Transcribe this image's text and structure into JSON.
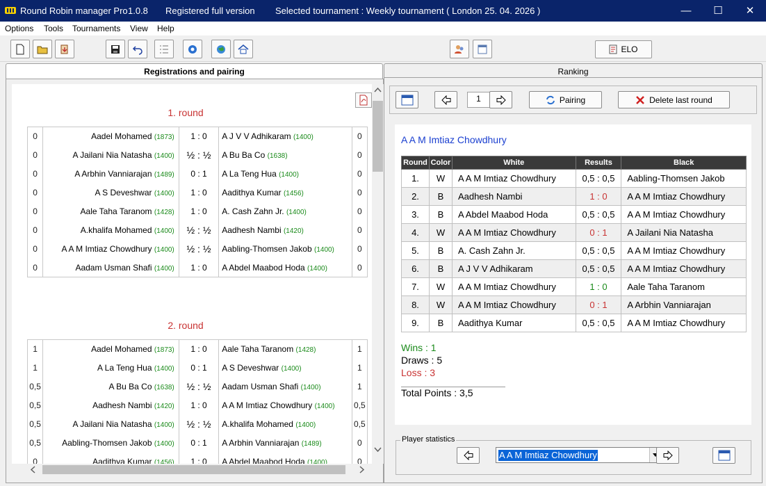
{
  "titlebar": {
    "app_name": "Round Robin manager Pro",
    "version": "1.0.8",
    "license": "Registered full version",
    "selected_tournament": "Selected tournament : Weekly tournament  ( London 25. 04. 2026 )",
    "minimize": "—",
    "maximize": "☐",
    "close": "✕"
  },
  "menu": {
    "options": "Options",
    "tools": "Tools",
    "tournaments": "Tournaments",
    "view": "View",
    "help": "Help"
  },
  "toolbar": {
    "elo_label": "ELO"
  },
  "tabs": {
    "registrations": "Registrations and pairing",
    "ranking": "Ranking"
  },
  "rounds": [
    {
      "title": "1. round",
      "pairings": [
        {
          "ws": "0",
          "white": "Aadel Mohamed",
          "wr": "(1873)",
          "result": "1 : 0",
          "black": "A J V V Adhikaram",
          "br": "(1400)",
          "bs": "0"
        },
        {
          "ws": "0",
          "white": "A Jailani Nia Natasha",
          "wr": "(1400)",
          "result": "½ : ½",
          "black": "A Bu Ba Co",
          "br": "(1638)",
          "bs": "0"
        },
        {
          "ws": "0",
          "white": "A Arbhin Vanniarajan",
          "wr": "(1489)",
          "result": "0 : 1",
          "black": "A La Teng Hua",
          "br": "(1400)",
          "bs": "0"
        },
        {
          "ws": "0",
          "white": "A S Deveshwar",
          "wr": "(1400)",
          "result": "1 : 0",
          "black": "Aadithya Kumar",
          "br": "(1456)",
          "bs": "0"
        },
        {
          "ws": "0",
          "white": "Aale Taha Taranom",
          "wr": "(1428)",
          "result": "1 : 0",
          "black": "A. Cash Zahn Jr.",
          "br": "(1400)",
          "bs": "0"
        },
        {
          "ws": "0",
          "white": "A.khalifa Mohamed",
          "wr": "(1400)",
          "result": "½ : ½",
          "black": "Aadhesh Nambi",
          "br": "(1420)",
          "bs": "0"
        },
        {
          "ws": "0",
          "white": "A A M Imtiaz Chowdhury",
          "wr": "(1400)",
          "result": "½ : ½",
          "black": "Aabling-Thomsen Jakob",
          "br": "(1400)",
          "bs": "0"
        },
        {
          "ws": "0",
          "white": "Aadam Usman Shafi",
          "wr": "(1400)",
          "result": "1 : 0",
          "black": "A Abdel Maabod Hoda",
          "br": "(1400)",
          "bs": "0"
        }
      ]
    },
    {
      "title": "2. round",
      "pairings": [
        {
          "ws": "1",
          "white": "Aadel Mohamed",
          "wr": "(1873)",
          "result": "1 : 0",
          "black": "Aale Taha Taranom",
          "br": "(1428)",
          "bs": "1"
        },
        {
          "ws": "1",
          "white": "A La Teng Hua",
          "wr": "(1400)",
          "result": "0 : 1",
          "black": "A S Deveshwar",
          "br": "(1400)",
          "bs": "1"
        },
        {
          "ws": "0,5",
          "white": "A Bu Ba Co",
          "wr": "(1638)",
          "result": "½ : ½",
          "black": "Aadam Usman Shafi",
          "br": "(1400)",
          "bs": "1"
        },
        {
          "ws": "0,5",
          "white": "Aadhesh Nambi",
          "wr": "(1420)",
          "result": "1 : 0",
          "black": "A A M Imtiaz Chowdhury",
          "br": "(1400)",
          "bs": "0,5"
        },
        {
          "ws": "0,5",
          "white": "A Jailani Nia Natasha",
          "wr": "(1400)",
          "result": "½ : ½",
          "black": "A.khalifa Mohamed",
          "br": "(1400)",
          "bs": "0,5"
        },
        {
          "ws": "0,5",
          "white": "Aabling-Thomsen Jakob",
          "wr": "(1400)",
          "result": "0 : 1",
          "black": "A Arbhin Vanniarajan",
          "br": "(1489)",
          "bs": "0"
        },
        {
          "ws": "0",
          "white": "Aadithya Kumar",
          "wr": "(1456)",
          "result": "1 : 0",
          "black": "A Abdel Maabod Hoda",
          "br": "(1400)",
          "bs": "0"
        }
      ]
    }
  ],
  "pairing_controls": {
    "round_number": "1",
    "pairing_label": "Pairing",
    "delete_label": "Delete last round"
  },
  "player_stats": {
    "name": "A A M Imtiaz Chowdhury",
    "headers": [
      "Round",
      "Color",
      "White",
      "Results",
      "Black"
    ],
    "games": [
      {
        "round": "1.",
        "color": "W",
        "white": "A A M Imtiaz Chowdhury",
        "result": "0,5 : 0,5",
        "black": "Aabling-Thomsen Jakob",
        "outcome": "draw"
      },
      {
        "round": "2.",
        "color": "B",
        "white": "Aadhesh Nambi",
        "result": "1 : 0",
        "black": "A A M Imtiaz Chowdhury",
        "outcome": "loss"
      },
      {
        "round": "3.",
        "color": "B",
        "white": "A Abdel Maabod Hoda",
        "result": "0,5 : 0,5",
        "black": "A A M Imtiaz Chowdhury",
        "outcome": "draw"
      },
      {
        "round": "4.",
        "color": "W",
        "white": "A A M Imtiaz Chowdhury",
        "result": "0 : 1",
        "black": "A Jailani Nia Natasha",
        "outcome": "loss"
      },
      {
        "round": "5.",
        "color": "B",
        "white": "A. Cash Zahn Jr.",
        "result": "0,5 : 0,5",
        "black": "A A M Imtiaz Chowdhury",
        "outcome": "draw"
      },
      {
        "round": "6.",
        "color": "B",
        "white": "A J V V Adhikaram",
        "result": "0,5 : 0,5",
        "black": "A A M Imtiaz Chowdhury",
        "outcome": "draw"
      },
      {
        "round": "7.",
        "color": "W",
        "white": "A A M Imtiaz Chowdhury",
        "result": "1 : 0",
        "black": "Aale Taha Taranom",
        "outcome": "win"
      },
      {
        "round": "8.",
        "color": "W",
        "white": "A A M Imtiaz Chowdhury",
        "result": "0 : 1",
        "black": "A Arbhin Vanniarajan",
        "outcome": "loss"
      },
      {
        "round": "9.",
        "color": "B",
        "white": "Aadithya Kumar",
        "result": "0,5 : 0,5",
        "black": "A A M Imtiaz Chowdhury",
        "outcome": "draw"
      }
    ],
    "wins": "Wins : 1",
    "draws": "Draws : 5",
    "loss": "Loss : 3",
    "total": "Total Points : 3,5"
  },
  "player_statistics_group": {
    "label": "Player statistics",
    "selected_player": "A A M Imtiaz Chowdhury"
  },
  "colors": {
    "title_bg": "#0a246a",
    "win": "#1a8a1a",
    "loss": "#c83232",
    "player_name": "#1a3fd0",
    "rating": "#1a8a1a"
  }
}
